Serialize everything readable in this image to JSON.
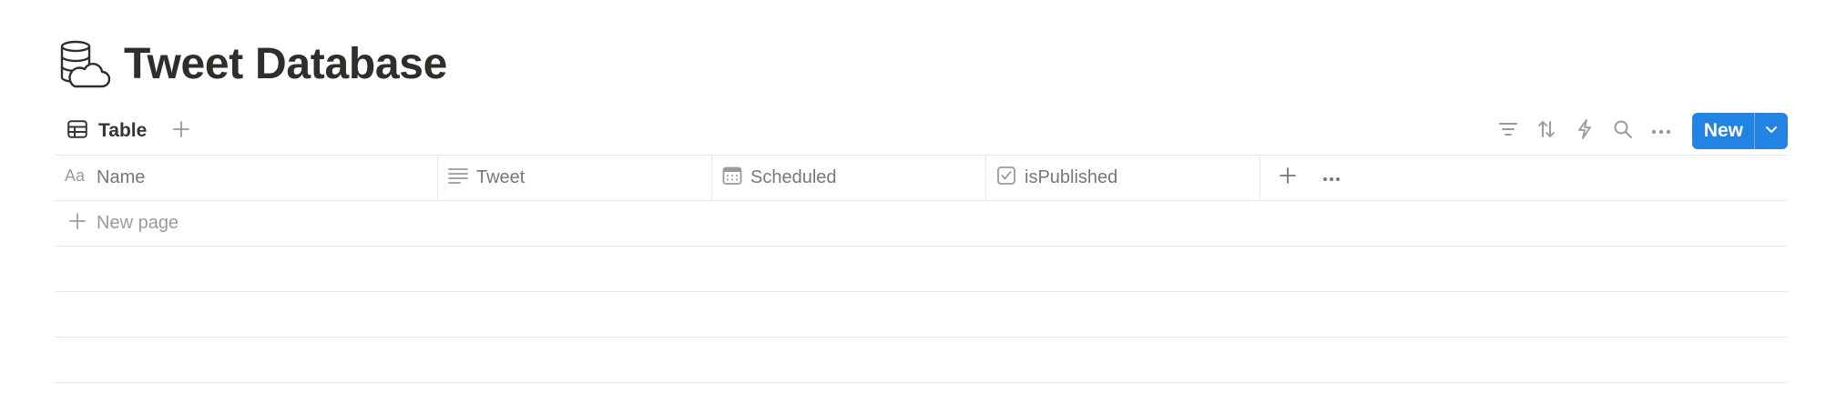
{
  "page": {
    "icon": "database-cloud-icon",
    "title": "Tweet Database"
  },
  "view_bar": {
    "tabs": [
      {
        "label": "Table",
        "icon": "table-icon",
        "active": true
      }
    ],
    "add_view_icon": "plus-icon",
    "tools": [
      {
        "name": "filter",
        "icon": "filter-icon"
      },
      {
        "name": "sort",
        "icon": "sort-icon"
      },
      {
        "name": "automations",
        "icon": "lightning-icon"
      },
      {
        "name": "search",
        "icon": "search-icon"
      },
      {
        "name": "more",
        "icon": "more-icon"
      }
    ],
    "new_button": {
      "label": "New",
      "color": "#2383e2"
    }
  },
  "table": {
    "columns": [
      {
        "label": "Name",
        "icon": "title-property-icon"
      },
      {
        "label": "Tweet",
        "icon": "text-property-icon"
      },
      {
        "label": "Scheduled",
        "icon": "date-property-icon"
      },
      {
        "label": "isPublished",
        "icon": "checkbox-property-icon"
      }
    ],
    "add_column_icon": "plus-icon",
    "column_options_icon": "more-icon",
    "new_row_label": "New page",
    "empty_rows": 3
  },
  "colors": {
    "title": "#2f2e2a",
    "muted_text": "#787774",
    "placeholder_text": "#9b9a97",
    "border": "#e9e9e7",
    "accent": "#2383e2"
  }
}
